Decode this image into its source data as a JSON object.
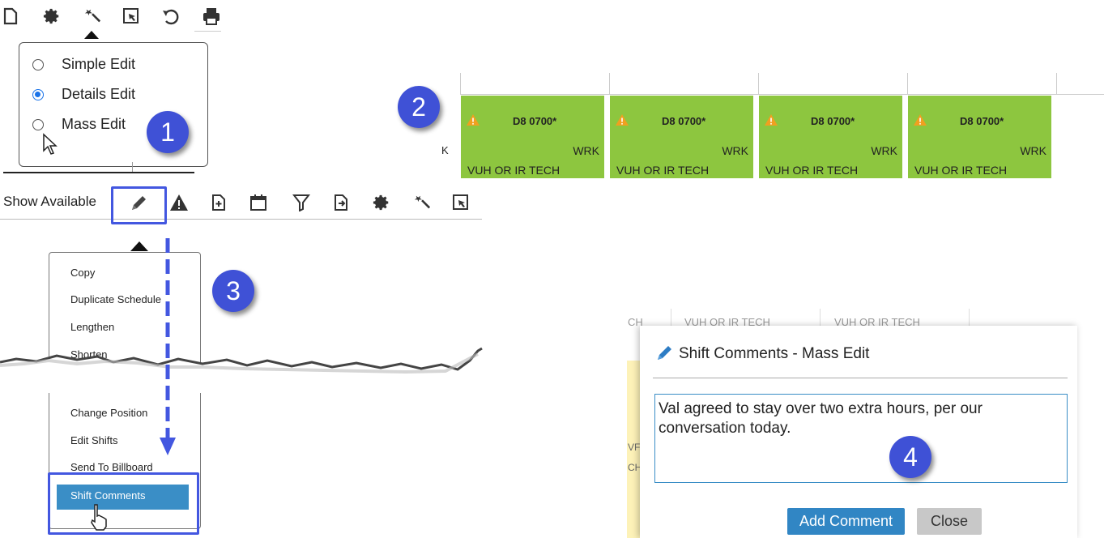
{
  "step_badges": [
    "1",
    "2",
    "3",
    "4"
  ],
  "edit_mode_menu": {
    "options": [
      {
        "label": "Simple Edit",
        "selected": false
      },
      {
        "label": "Details Edit",
        "selected": true
      },
      {
        "label": "Mass Edit",
        "selected": false
      }
    ]
  },
  "schedule": {
    "row_marker": "K",
    "shifts": [
      {
        "code": "D8 0700*",
        "type": "WRK",
        "location": "VUH OR IR TECH"
      },
      {
        "code": "D8 0700*",
        "type": "WRK",
        "location": "VUH OR IR TECH"
      },
      {
        "code": "D8 0700*",
        "type": "WRK",
        "location": "VUH OR IR TECH"
      },
      {
        "code": "D8 0700*",
        "type": "WRK",
        "location": "VUH OR IR TECH"
      }
    ]
  },
  "toolbar": {
    "show_available_label": "Show Available"
  },
  "action_menu": {
    "items_top": [
      "Copy",
      "Duplicate Schedule",
      "Lengthen",
      "Shorten"
    ],
    "items_bottom": [
      "Change Position",
      "Edit Shifts",
      "Send To Billboard"
    ],
    "selected_item": "Shift Comments"
  },
  "background_partial": {
    "left_fragment": "CH",
    "cells": [
      "VUH OR IR TECH",
      "VUH OR IR TECH"
    ],
    "side_fragments": [
      "VF",
      "CH"
    ]
  },
  "comment_dialog": {
    "title": "Shift Comments - Mass Edit",
    "comment_text": "Val agreed to stay over two extra hours, per our conversation today.",
    "add_button": "Add Comment",
    "close_button": "Close"
  },
  "colors": {
    "badge": "#3f51d6",
    "shift_cell": "#8dc63f",
    "menu_selected": "#3a8ec6",
    "primary_button": "#3186c4",
    "highlight": "#4357e0"
  }
}
